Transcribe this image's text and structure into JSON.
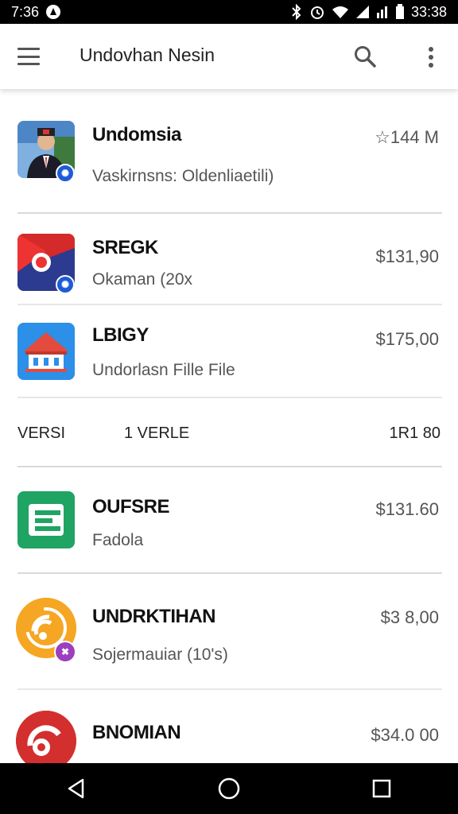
{
  "status_bar": {
    "time_left": "7:36",
    "time_right": "33:38"
  },
  "app_bar": {
    "title": "Undovhan Nesin"
  },
  "apps": [
    {
      "name": "Undomsia",
      "subtitle": "Vaskirnsns: Oldenliaetili)",
      "price": "☆144 M",
      "icon": "profile-photo-icon",
      "badge": "verified-badge-icon"
    },
    {
      "name": "SREGK",
      "subtitle": "Okaman (20x",
      "price": "$131,90",
      "icon": "flag-icon",
      "badge": "verified-badge-icon"
    },
    {
      "name": "LBIGY",
      "subtitle": "Undorlasn Fille File",
      "price": "$175,00",
      "icon": "house-icon"
    },
    {
      "name": "OUFSRE",
      "subtitle": "Fadola",
      "price": "$131.60",
      "icon": "document-app-icon"
    },
    {
      "name": "UNDRKTIHAN",
      "subtitle": "Sojermauiar (10's)",
      "price": "$3 8,00",
      "icon": "rss-app-icon",
      "badge": "tools-badge-icon"
    },
    {
      "name": "BNOMIAN",
      "subtitle": "",
      "price": "$34.0 00",
      "icon": "red-circle-app-icon"
    }
  ],
  "version_row": {
    "label": "VERSI",
    "value": "1 VERLE",
    "count": "1R1 80"
  },
  "colors": {
    "appbar": "#ffffff",
    "statusbar": "#000000",
    "navbar": "#000000",
    "divider": "#d9d9d9",
    "green": "#1fa463",
    "orange": "#f5a623",
    "red": "#d32f2f",
    "blue": "#2196f3"
  }
}
